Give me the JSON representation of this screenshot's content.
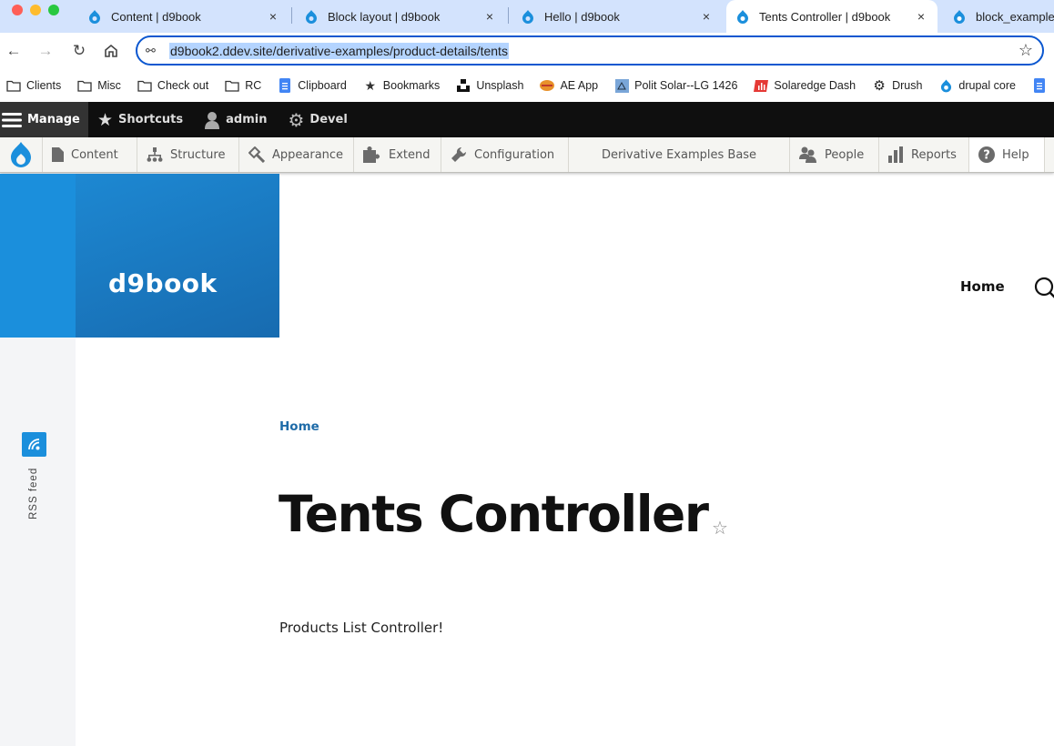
{
  "browser": {
    "tabs": [
      {
        "title": "Content | d9book",
        "icon": "drupal-icon",
        "active": false
      },
      {
        "title": "Block layout | d9book",
        "icon": "drupal-icon",
        "active": false
      },
      {
        "title": "Hello | d9book",
        "icon": "drupal-icon",
        "active": false
      },
      {
        "title": "Tents Controller | d9book",
        "icon": "drupal-icon",
        "active": true
      },
      {
        "title": "block_examples",
        "icon": "drupal-icon",
        "active": false
      }
    ],
    "close_glyph": "×",
    "url": "d9book2.ddev.site/derivative-examples/product-details/tents",
    "bookmarks": [
      {
        "label": "Clients",
        "icon": "folder-icon"
      },
      {
        "label": "Misc",
        "icon": "folder-icon"
      },
      {
        "label": "Check out",
        "icon": "folder-icon"
      },
      {
        "label": "RC",
        "icon": "folder-icon"
      },
      {
        "label": "Clipboard",
        "icon": "doc-icon"
      },
      {
        "label": "Bookmarks",
        "icon": "star-icon"
      },
      {
        "label": "Unsplash",
        "icon": "unsplash-icon"
      },
      {
        "label": "AE App",
        "icon": "ae-app-icon"
      },
      {
        "label": "Polit Solar--LG 1426",
        "icon": "solar-icon"
      },
      {
        "label": "Solaredge Dash",
        "icon": "chart-icon"
      },
      {
        "label": "Drush",
        "icon": "gear-icon"
      },
      {
        "label": "drupal core",
        "icon": "drupal-icon"
      }
    ]
  },
  "toolbar": {
    "bar": [
      {
        "label": "Manage",
        "icon": "menu-icon"
      },
      {
        "label": "Shortcuts",
        "icon": "star-icon"
      },
      {
        "label": "admin",
        "icon": "user-icon"
      },
      {
        "label": "Devel",
        "icon": "gear-icon"
      }
    ],
    "tray": [
      {
        "label": "Content",
        "icon": "file-icon"
      },
      {
        "label": "Structure",
        "icon": "sitemap-icon"
      },
      {
        "label": "Appearance",
        "icon": "paintbrush-icon"
      },
      {
        "label": "Extend",
        "icon": "puzzle-icon"
      },
      {
        "label": "Configuration",
        "icon": "wrench-icon"
      },
      {
        "label": "Derivative Examples Base",
        "icon": ""
      },
      {
        "label": "People",
        "icon": "people-icon"
      },
      {
        "label": "Reports",
        "icon": "bar-chart-icon"
      },
      {
        "label": "Help",
        "icon": "help-icon"
      }
    ]
  },
  "site": {
    "name": "d9book",
    "main_nav": [
      {
        "label": "Home"
      }
    ],
    "rss_label": "RSS feed",
    "brand_color": "#1b8fdc"
  },
  "page": {
    "breadcrumb": [
      {
        "label": "Home"
      }
    ],
    "title": "Tents Controller",
    "body": "Products List Controller!"
  }
}
